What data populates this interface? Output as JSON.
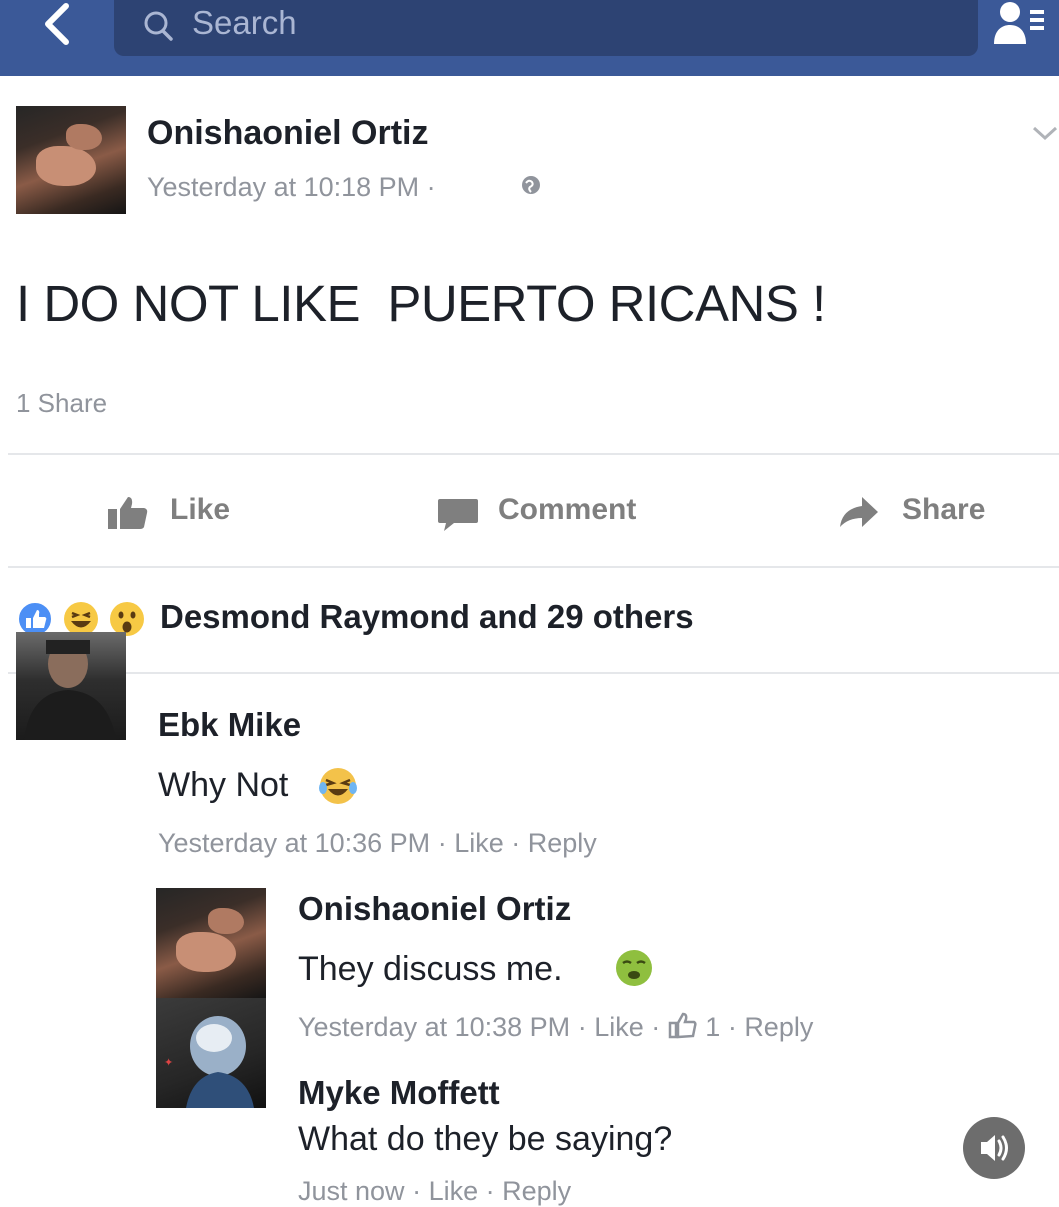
{
  "header": {
    "search_placeholder": "Search",
    "accent_color": "#3b5998"
  },
  "post": {
    "author": "Onishaoniel Ortiz",
    "timestamp": "Yesterday at 10:18 PM · ",
    "text": "I DO NOT LIKE  PUERTO RICANS !",
    "share_count": "1 Share",
    "actions": {
      "like": "Like",
      "comment": "Comment",
      "share": "Share"
    },
    "reactions_summary": "Desmond Raymond and 29 others"
  },
  "comments": [
    {
      "author": "Ebk Mike",
      "text": "Why Not",
      "emoji": "crying-laughing-icon",
      "time": "Yesterday at 10:36 PM",
      "like": "Like",
      "reply": "Reply"
    },
    {
      "author": "Onishaoniel Ortiz",
      "text": "They discuss me.",
      "emoji": "nauseated-face-icon",
      "time": "Yesterday at 10:38 PM",
      "like": "Like",
      "like_count": "1",
      "reply": "Reply"
    },
    {
      "author": "Myke Moffett",
      "text": "What do they be saying?",
      "time": "Just now",
      "like": "Like",
      "reply": "Reply"
    }
  ]
}
